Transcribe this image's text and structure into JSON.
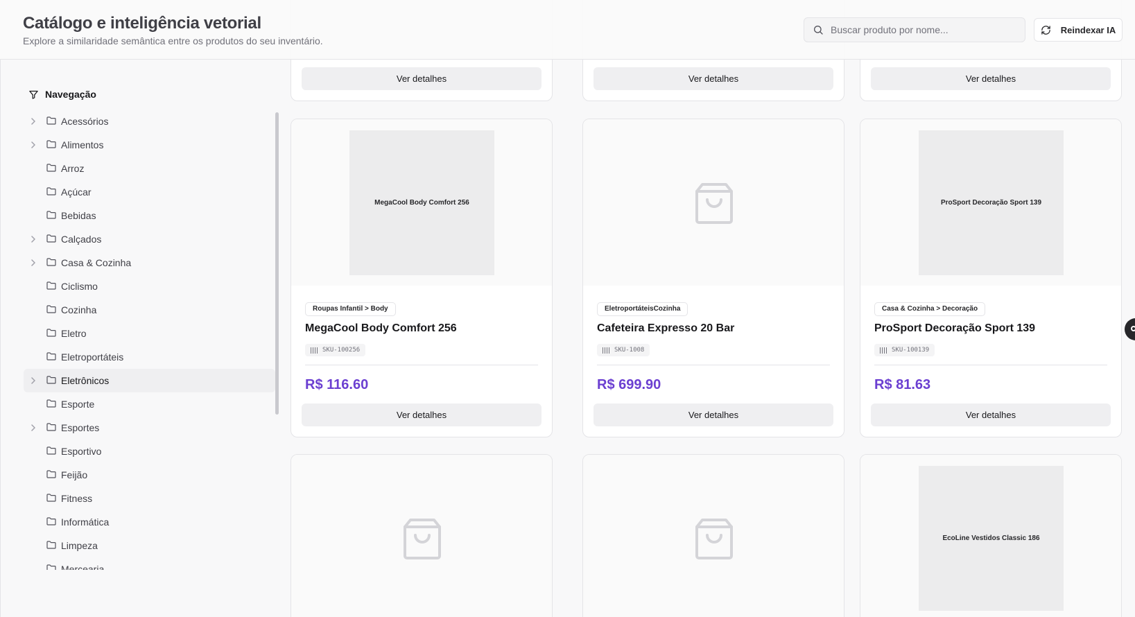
{
  "header": {
    "title": "Catálogo e inteligência vetorial",
    "subtitle": "Explore a similaridade semântica entre os produtos do seu inventário.",
    "search_placeholder": "Buscar produto por nome...",
    "reindex_label": "Reindexar IA"
  },
  "sidebar": {
    "heading": "Navegação",
    "items": [
      {
        "label": "Acessórios",
        "expandable": true
      },
      {
        "label": "Alimentos",
        "expandable": true
      },
      {
        "label": "Arroz",
        "expandable": false
      },
      {
        "label": "Açúcar",
        "expandable": false
      },
      {
        "label": "Bebidas",
        "expandable": false
      },
      {
        "label": "Calçados",
        "expandable": true
      },
      {
        "label": "Casa & Cozinha",
        "expandable": true
      },
      {
        "label": "Ciclismo",
        "expandable": false
      },
      {
        "label": "Cozinha",
        "expandable": false
      },
      {
        "label": "Eletro",
        "expandable": false
      },
      {
        "label": "Eletroportáteis",
        "expandable": false
      },
      {
        "label": "Eletrônicos",
        "expandable": true,
        "active": true
      },
      {
        "label": "Esporte",
        "expandable": false
      },
      {
        "label": "Esportes",
        "expandable": true
      },
      {
        "label": "Esportivo",
        "expandable": false
      },
      {
        "label": "Feijão",
        "expandable": false
      },
      {
        "label": "Fitness",
        "expandable": false
      },
      {
        "label": "Informática",
        "expandable": false
      },
      {
        "label": "Limpeza",
        "expandable": false
      },
      {
        "label": "Mercearia",
        "expandable": false
      }
    ]
  },
  "products": {
    "top_row": [
      {
        "button": "Ver detalhes"
      },
      {
        "button": "Ver detalhes"
      },
      {
        "button": "Ver detalhes"
      }
    ],
    "middle_row": [
      {
        "image_text": "MegaCool Body Comfort 256",
        "category": "Roupas Infantil > Body",
        "name": "MegaCool Body Comfort 256",
        "sku": "SKU-100256",
        "price": "R$ 116.60",
        "button": "Ver detalhes"
      },
      {
        "image_text": "",
        "category": "EletroportáteisCozinha",
        "name": "Cafeteira Expresso 20 Bar",
        "sku": "SKU-1008",
        "price": "R$ 699.90",
        "button": "Ver detalhes"
      },
      {
        "image_text": "ProSport Decoração Sport 139",
        "category": "Casa & Cozinha > Decoração",
        "name": "ProSport Decoração Sport 139",
        "sku": "SKU-100139",
        "price": "R$ 81.63",
        "button": "Ver detalhes"
      }
    ],
    "bottom_row": [
      {
        "image_text": ""
      },
      {
        "image_text": ""
      },
      {
        "image_text": "EcoLine Vestidos Classic 186"
      }
    ]
  },
  "icons": {
    "search": "search-icon",
    "reindex": "refresh-icon",
    "navigation": "filter-icon",
    "folder": "folder-icon",
    "chevron": "chevron-right-icon",
    "placeholder": "shopping-bag-icon",
    "sku": "barcode-icon"
  },
  "colors": {
    "price": "#6b3fd1",
    "active_nav_bg": "#efeff1",
    "button_bg": "#efeff1"
  }
}
